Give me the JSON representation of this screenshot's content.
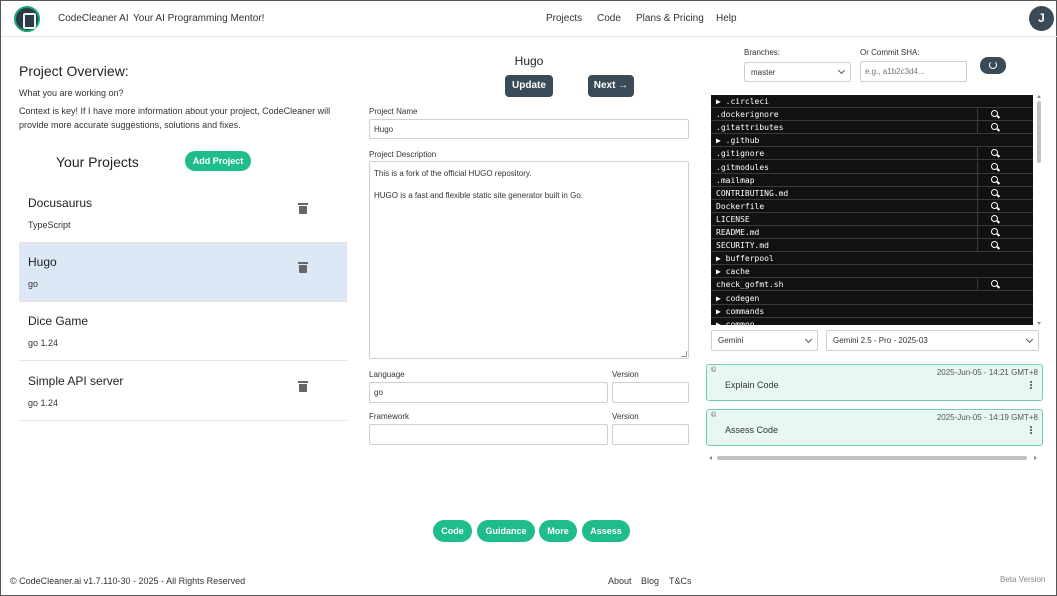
{
  "header": {
    "brand": "CodeCleaner AI",
    "tagline": "Your AI Programming Mentor!",
    "nav": [
      "Projects",
      "Code",
      "Plans & Pricing",
      "Help"
    ],
    "avatar_initial": "J"
  },
  "overview": {
    "title": "Project Overview:",
    "question": "What you are working on?",
    "context": "Context is key! If I have more information about your project, CodeCleaner will provide more accurate suggestions, solutions and fixes."
  },
  "projects": {
    "heading": "Your Projects",
    "add_label": "Add Project",
    "items": [
      {
        "name": "Docusaurus",
        "lang": "TypeScript",
        "selected": false,
        "deletable": true
      },
      {
        "name": "Hugo",
        "lang": "go",
        "selected": true,
        "deletable": true
      },
      {
        "name": "Dice Game",
        "lang": "go  1.24",
        "selected": false,
        "deletable": false
      },
      {
        "name": "Simple API server",
        "lang": "go  1.24",
        "selected": false,
        "deletable": true
      }
    ]
  },
  "form": {
    "title": "Hugo",
    "update_label": "Update",
    "next_label": "Next →",
    "name_label": "Project Name",
    "name_value": "Hugo",
    "desc_label": "Project Description",
    "desc_line1": "This is a fork of the official HUGO repository.",
    "desc_line2": "HUGO is a fast and flexible static site generator built in Go.",
    "language_label": "Language",
    "language_value": "go",
    "version_label": "Version",
    "framework_label": "Framework",
    "version_label2": "Version"
  },
  "actions": [
    "Code",
    "Guidance",
    "More",
    "Assess"
  ],
  "repo": {
    "branches_label": "Branches:",
    "branch_value": "master",
    "sha_label": "Or Commit SHA:",
    "sha_placeholder": "e.g., a1b2c3d4...",
    "files": [
      {
        "name": "▶ .circleci",
        "folder": true
      },
      {
        "name": ".dockerignore",
        "folder": false
      },
      {
        "name": ".gitattributes",
        "folder": false
      },
      {
        "name": "▶ .github",
        "folder": true
      },
      {
        "name": ".gitignore",
        "folder": false
      },
      {
        "name": ".gitmodules",
        "folder": false
      },
      {
        "name": ".mailmap",
        "folder": false
      },
      {
        "name": "CONTRIBUTING.md",
        "folder": false
      },
      {
        "name": "Dockerfile",
        "folder": false
      },
      {
        "name": "LICENSE",
        "folder": false
      },
      {
        "name": "README.md",
        "folder": false
      },
      {
        "name": "SECURITY.md",
        "folder": false
      },
      {
        "name": "▶ bufferpool",
        "folder": true
      },
      {
        "name": "▶ cache",
        "folder": true
      },
      {
        "name": "check_gofmt.sh",
        "folder": false
      },
      {
        "name": "▶ codegen",
        "folder": true
      },
      {
        "name": "▶ commands",
        "folder": true
      },
      {
        "name": "▶ common",
        "folder": true
      }
    ],
    "provider_value": "Gemini",
    "model_value": "Gemini 2.5 - Pro - 2025-03"
  },
  "history": [
    {
      "badge": "©",
      "timestamp": "2025-Jun-05 - 14:21 GMT+8",
      "title": "Explain Code"
    },
    {
      "badge": "©",
      "timestamp": "2025-Jun-05 - 14:19 GMT+8",
      "title": "Assess Code"
    }
  ],
  "footer": {
    "copyright": "© CodeCleaner.ai v1.7.110-30 - 2025 - All Rights Reserved",
    "links": [
      "About",
      "Blog",
      "T&Cs"
    ],
    "beta": "Beta Version"
  },
  "colors": {
    "accent": "#1ebd8b",
    "dark": "#3a4b57",
    "selected": "#dce8f6"
  }
}
